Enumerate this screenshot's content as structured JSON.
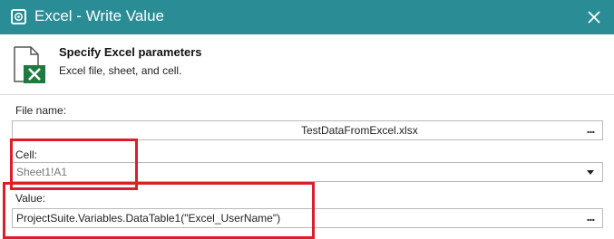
{
  "window": {
    "title": "Excel - Write Value",
    "icon": "app-logo-icon",
    "close_icon": "close-icon",
    "accent_color": "#2a8d96"
  },
  "header": {
    "title": "Specify Excel parameters",
    "subtitle": "Excel file, sheet, and cell.",
    "icon": "excel-file-icon"
  },
  "fields": {
    "file_name": {
      "label": "File name:",
      "value_visible": "TestDataFromExcel.xlsx",
      "button": "..."
    },
    "cell": {
      "label": "Cell:",
      "value": "Sheet1!A1",
      "button_icon": "chevron-down-icon"
    },
    "value": {
      "label": "Value:",
      "value": "ProjectSuite.Variables.DataTable1(\"Excel_UserName\")",
      "button": "..."
    }
  },
  "annotation_color": "#d9202a"
}
